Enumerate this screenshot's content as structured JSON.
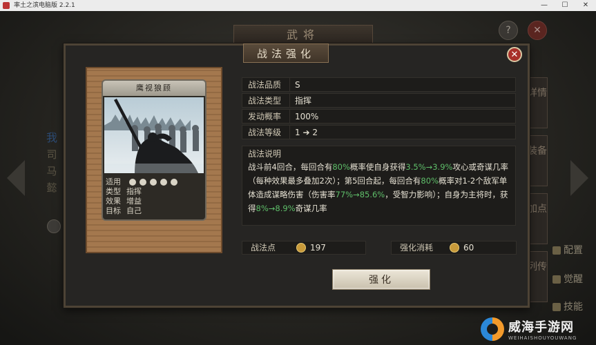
{
  "window": {
    "title": "率土之滨电脑版 2.2.1"
  },
  "background": {
    "title": "武将",
    "help_label": "?",
    "close_label": "✕",
    "left_general_chars": [
      "我",
      "司",
      "马",
      "懿"
    ],
    "side_tabs": [
      {
        "label": "详情"
      },
      {
        "label": "装备"
      },
      {
        "label": "加点"
      },
      {
        "label": "列传"
      }
    ],
    "right_items": [
      {
        "label": "配置"
      },
      {
        "label": "觉醒"
      },
      {
        "label": "技能"
      }
    ]
  },
  "dialog": {
    "title": "战法强化",
    "close_label": "✕",
    "card": {
      "name": "鹰视狼顾",
      "meta": [
        {
          "key": "适用",
          "value": ""
        },
        {
          "key": "类型",
          "value": "指挥"
        },
        {
          "key": "效果",
          "value": "增益"
        },
        {
          "key": "目标",
          "value": "自己"
        }
      ],
      "applicable_icons": [
        "horse-icon",
        "shield-icon",
        "crossed-swords-icon",
        "spear-icon",
        "crossbow-icon"
      ]
    },
    "info": [
      {
        "label": "战法品质",
        "value": "S"
      },
      {
        "label": "战法类型",
        "value": "指挥"
      },
      {
        "label": "发动概率",
        "value": "100%"
      },
      {
        "label": "战法等级",
        "value_from": "1",
        "arrow": "➔",
        "value_to": "2"
      }
    ],
    "description": {
      "label": "战法说明",
      "segments": [
        {
          "text": "战斗前4回合，每回合有",
          "hl": false
        },
        {
          "text": "80%",
          "hl": true
        },
        {
          "text": "概率使自身获得",
          "hl": false
        },
        {
          "text": "3.5%→3.9%",
          "hl": true
        },
        {
          "text": "攻心或奇谋几率（每种效果最多叠加2次）；第5回合起，每回合有",
          "hl": false
        },
        {
          "text": "80%",
          "hl": true
        },
        {
          "text": "概率对1-2个敌军单体造成谋略伤害（伤害率",
          "hl": false
        },
        {
          "text": "77%→85.6%",
          "hl": true
        },
        {
          "text": "，受智力影响）；自身为主将时，获得",
          "hl": false
        },
        {
          "text": "8%→8.9%",
          "hl": true
        },
        {
          "text": "奇谋几率",
          "hl": false
        }
      ]
    },
    "points": {
      "label": "战法点",
      "value": "197"
    },
    "cost": {
      "label": "强化消耗",
      "value": "60"
    },
    "enhance_button": "强化"
  },
  "watermark": {
    "text": "威海手游网",
    "sub": "WEIHAISHOUYOUWANG"
  }
}
